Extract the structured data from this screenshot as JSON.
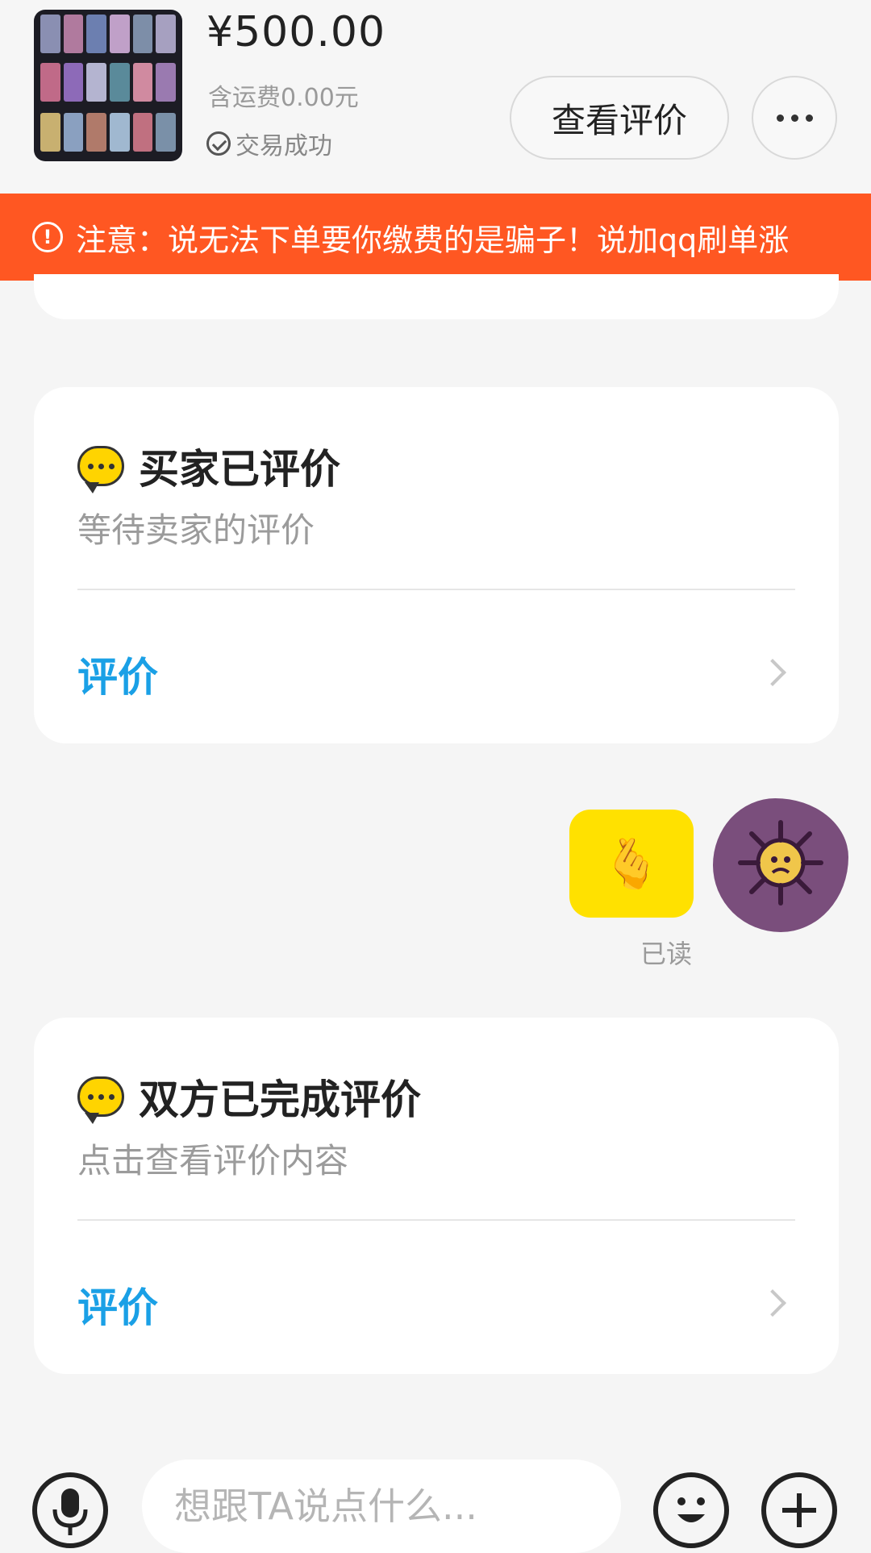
{
  "product": {
    "price": "¥500.00",
    "shipping": "含运费0.00元",
    "status": "交易成功",
    "view_review_label": "查看评价"
  },
  "notice": {
    "text": "注意：说无法下单要你缴费的是骗子！说加qq刷单涨"
  },
  "cards": [
    {
      "title": "买家已评价",
      "subtitle": "等待卖家的评价",
      "action": "评价"
    },
    {
      "title": "双方已完成评价",
      "subtitle": "点击查看评价内容",
      "action": "评价"
    }
  ],
  "message": {
    "read_status": "已读",
    "sticker": "🫰"
  },
  "input": {
    "placeholder": "想跟TA说点什么..."
  },
  "colors": {
    "notice_bg": "#ff5722",
    "action_blue": "#1aa0e6",
    "sticker_yellow": "#ffe100",
    "chat_icon_yellow": "#ffd400"
  },
  "icons": [
    "check-circle-icon",
    "more-dots-icon",
    "warning-icon",
    "chat-bubble-icon",
    "chevron-right-icon",
    "microphone-icon",
    "emoji-icon",
    "plus-icon"
  ]
}
